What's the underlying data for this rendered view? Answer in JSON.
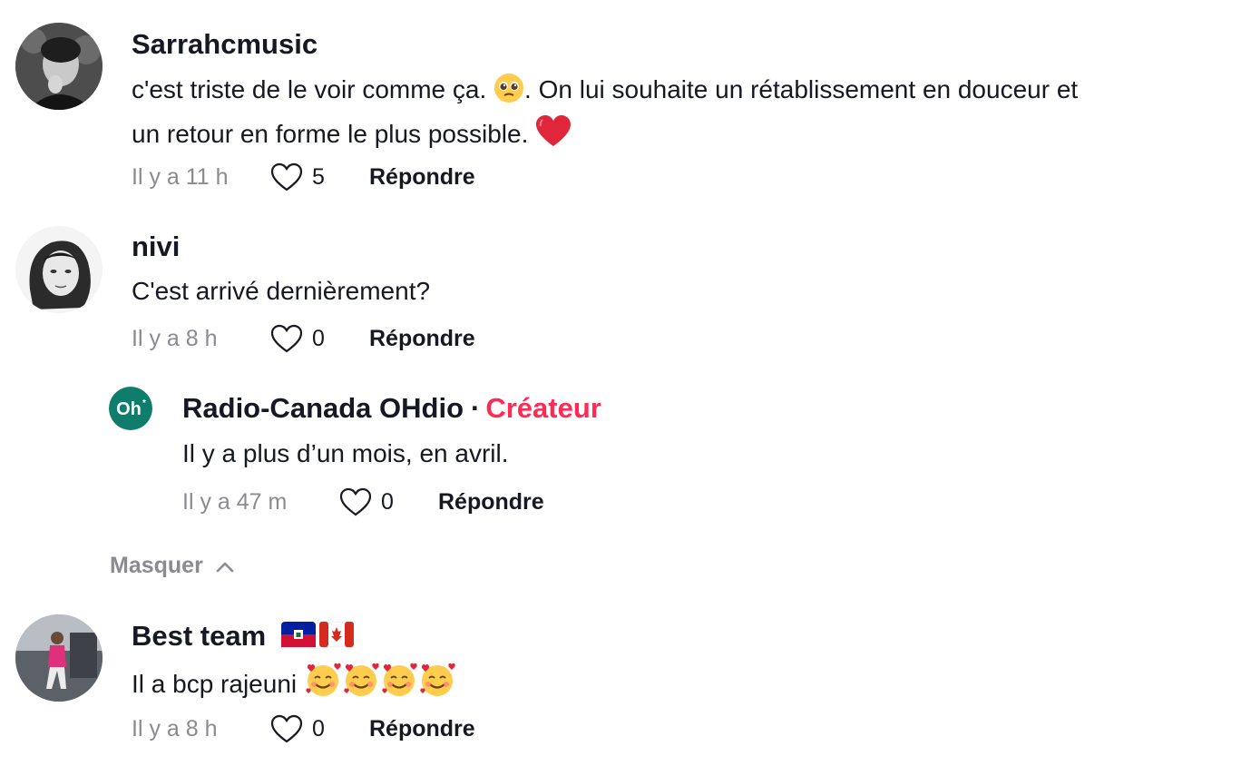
{
  "comments": [
    {
      "username": "Sarrahcmusic",
      "text_line1_a": "c'est triste de le voir comme ça. ",
      "text_line1_b": ". On lui souhaite un rétablissement en douceur et",
      "text_line2": "un retour en forme le plus possible. ",
      "emojis": [
        "pleading-face-icon",
        "red-heart-icon"
      ],
      "time": "Il y a 11 h",
      "likes": "5",
      "reply_label": "Répondre"
    },
    {
      "username": "nivi",
      "text": "C'est arrivé dernièrement?",
      "time": "Il y a 8 h",
      "likes": "0",
      "reply_label": "Répondre",
      "replies": [
        {
          "username": "Radio-Canada OHdio",
          "badge_sep": "·",
          "badge": "Créateur",
          "avatar_text": "Oh",
          "text": "Il y a plus d’un mois, en avril.",
          "time": "Il y a 47 m",
          "likes": "0",
          "reply_label": "Répondre"
        }
      ],
      "hide_label": "Masquer"
    },
    {
      "username": "Best team",
      "flags": [
        "haiti-flag-icon",
        "canada-flag-icon"
      ],
      "text": "Il a bcp rajeuni ",
      "emojis": [
        "smiling-face-with-hearts-icon",
        "smiling-face-with-hearts-icon",
        "smiling-face-with-hearts-icon",
        "smiling-face-with-hearts-icon"
      ],
      "time": "Il y a 8 h",
      "likes": "0",
      "reply_label": "Répondre"
    }
  ],
  "colors": {
    "creator": "#fe2c55",
    "muted": "#8a8b91",
    "text": "#161823",
    "brand_avatar": "#0f7d6c"
  }
}
